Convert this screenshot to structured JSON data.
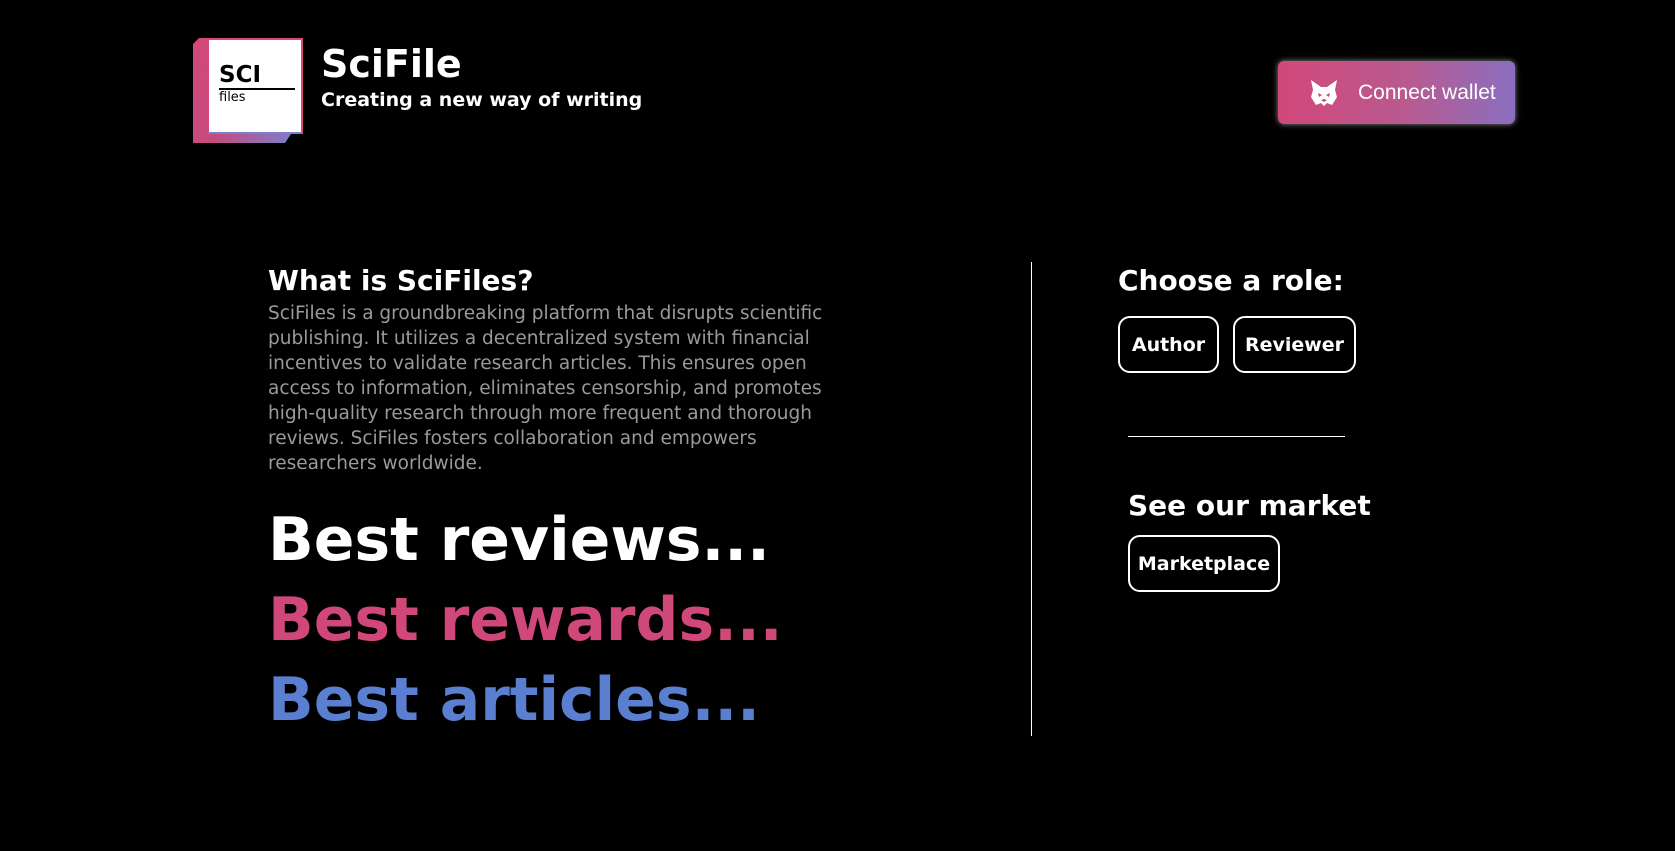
{
  "header": {
    "logo": {
      "main_text": "SCI",
      "sub_text": "files"
    },
    "title": "SciFile",
    "subtitle": "Creating a new way of writing",
    "connect_button": {
      "label": "Connect wallet",
      "icon": "metamask-fox-icon"
    }
  },
  "about": {
    "heading": "What is SciFiles?",
    "body": "SciFiles is a groundbreaking platform that disrupts scientific publishing. It utilizes a decentralized system with financial incentives to validate research articles. This ensures open access to information, eliminates censorship, and promotes high-quality research through more frequent and thorough reviews. SciFiles fosters collaboration and empowers researchers worldwide."
  },
  "slogans": [
    {
      "text": "Best reviews...",
      "color": "#ffffff"
    },
    {
      "text": "Best rewards...",
      "color": "#d0487a"
    },
    {
      "text": "Best articles...",
      "color": "#5a7fd0"
    }
  ],
  "roles": {
    "heading": "Choose a role:",
    "buttons": [
      "Author",
      "Reviewer"
    ]
  },
  "market": {
    "heading": "See our market",
    "button": "Marketplace"
  },
  "colors": {
    "background": "#000000",
    "accent_pink": "#d0487a",
    "accent_blue": "#5a7fd0",
    "muted_text": "#9a9a9a"
  }
}
